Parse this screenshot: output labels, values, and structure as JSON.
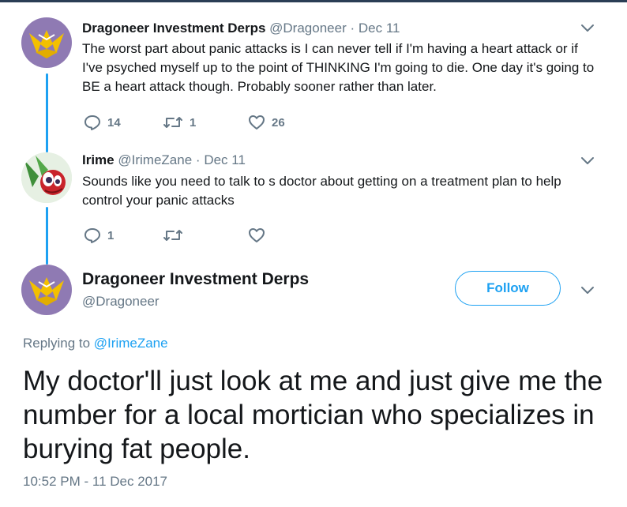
{
  "tweets": [
    {
      "name": "Dragoneer Investment Derps",
      "handle": "@Dragoneer",
      "dot": "·",
      "date": "Dec 11",
      "text": "The worst part about panic attacks is I can never tell if I'm having a heart attack or if I've psyched myself up to the point of THINKING I'm going to die. One day it's going to BE a heart attack though. Probably sooner rather than later.",
      "replies": "14",
      "retweets": "1",
      "likes": "26",
      "avatar_icon": "dragon-crest-avatar"
    },
    {
      "name": "Irime",
      "handle": "@IrimeZane",
      "dot": "·",
      "date": "Dec 11",
      "text": "Sounds like you need to talk to s doctor about getting on a treatment plan to help control your panic attacks",
      "replies": "1",
      "retweets": "",
      "likes": "",
      "avatar_icon": "cartoon-avatar"
    }
  ],
  "main_tweet": {
    "name": "Dragoneer Investment Derps",
    "handle": "@Dragoneer",
    "follow_label": "Follow",
    "replying_prefix": "Replying to",
    "replying_to": "@IrimeZane",
    "text": "My doctor'll just look at me and just give me the number for a local mortician who specializes in burying fat people.",
    "timestamp": "10:52 PM - 11 Dec 2017"
  },
  "colors": {
    "accent": "#1da1f2",
    "muted": "#657786",
    "text": "#14171a",
    "avatar_purple": "#8f7ab3",
    "crest_gold": "#f3c000"
  },
  "icons": [
    "reply-icon",
    "retweet-icon",
    "like-icon",
    "chevron-down-icon"
  ]
}
